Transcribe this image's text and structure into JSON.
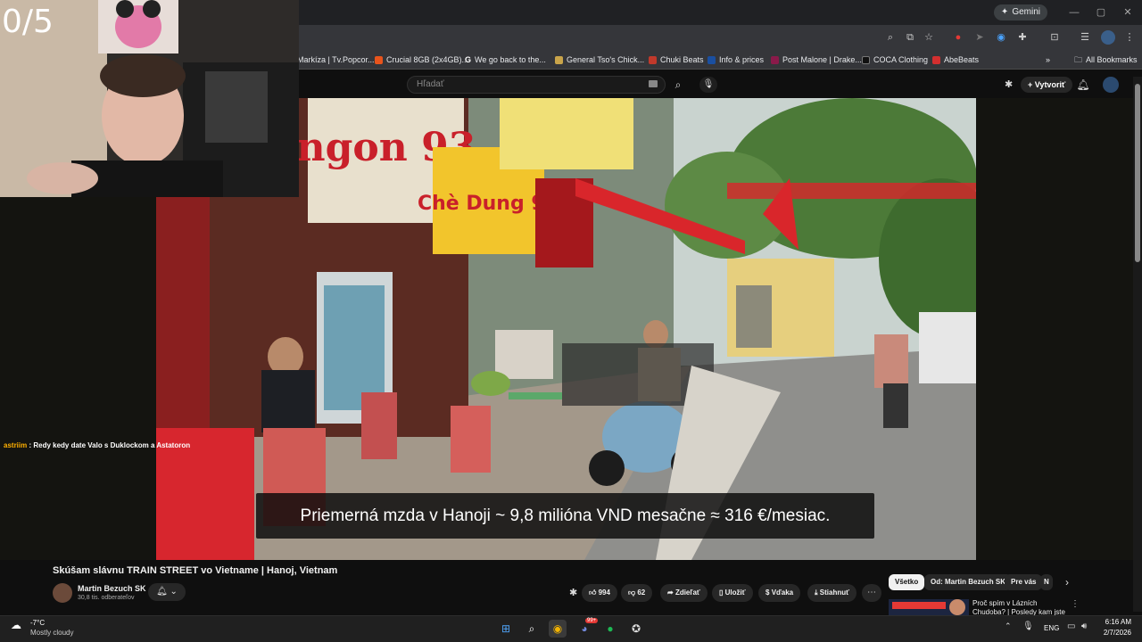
{
  "overlay": {
    "counter": "0/5",
    "chat": {
      "user": "astriim",
      "message": " : Redy kedy date Valo s Duklockom a Astatoron"
    }
  },
  "browser": {
    "gemini_label": "Gemini",
    "bookmarks": [
      {
        "label": "Markíza | Tv.Popcor...",
        "color": "#7a3030"
      },
      {
        "label": "Crucial 8GB (2x4GB)...",
        "color": "#e8541c"
      },
      {
        "label": "We go back to the...",
        "color": "#ffffff"
      },
      {
        "label": "General Tso's Chick...",
        "color": "#c9a44a"
      },
      {
        "label": "Chuki Beats",
        "color": "#c0392b"
      },
      {
        "label": "Info & prices",
        "color": "#1a4fa0"
      },
      {
        "label": "Post Malone | Drake...",
        "color": "#8a1a4a"
      },
      {
        "label": "COCA Clothing",
        "color": "#111111"
      },
      {
        "label": "AbeBeats",
        "color": "#d32f2f"
      }
    ],
    "bookmarks_overflow": "»",
    "all_bookmarks": "All Bookmarks"
  },
  "youtube": {
    "search_placeholder": "Hľadať",
    "create_label": "Vytvoriť",
    "subtitle": "Priemerná mzda v Hanoji ~ 9,8 milióna VND mesačne ≈ 316 €/mesiac.",
    "video_title": "Skúšam slávnu TRAIN STREET vo Vietname | Hanoj, Vietnam",
    "channel_name": "Martin Bezuch SK",
    "channel_subs": "30,8 tis. odberateľov",
    "actions": {
      "likes": "994",
      "dislikes": "62",
      "share": "Zdieľať",
      "save": "Uložiť",
      "thanks": "Vďaka",
      "download": "Stiahnuť"
    },
    "chips": [
      "Všetko",
      "Od: Martin Bezuch SK",
      "Pre vás",
      "N"
    ],
    "recommendation": {
      "title": "Proč spím v Lázních Chudoba? | Posledy kam jste se vi Prvmi..."
    }
  },
  "taskbar": {
    "weather_temp": "-7°C",
    "weather_desc": "Mostly cloudy",
    "lang": "ENG",
    "time": "6:16 AM",
    "date": "2/7/2026",
    "notification_badge": "99+"
  },
  "colors": {
    "accent_red": "#ff0000",
    "chat_user": "#ffb000"
  }
}
